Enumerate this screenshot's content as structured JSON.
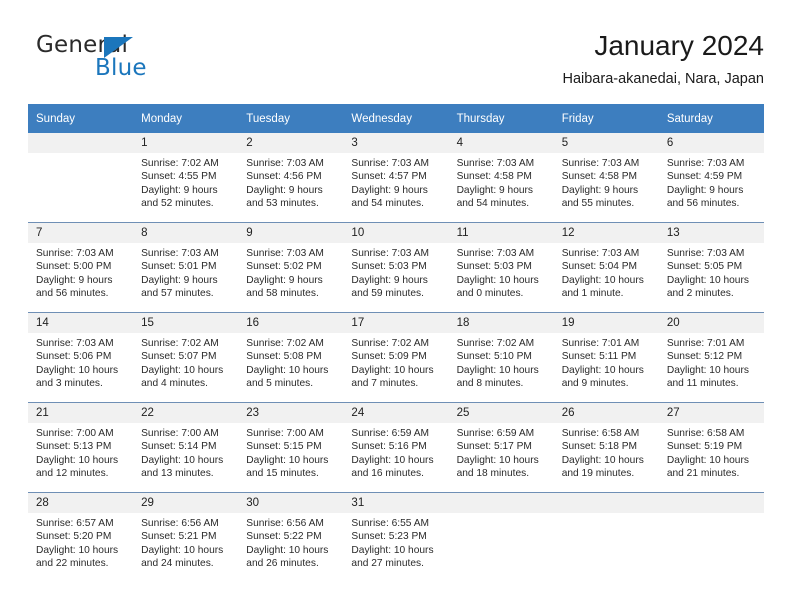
{
  "brand": {
    "word1": "General",
    "word2": "Blue",
    "triangle_color": "#1b76bc",
    "text_color": "#2b2b2b"
  },
  "header": {
    "title": "January 2024",
    "subtitle": "Haibara-akanedai, Nara, Japan"
  },
  "calendar": {
    "header_bg": "#3d7ebf",
    "header_text_color": "#ffffff",
    "daynum_bg": "#f1f1f1",
    "weekday_headers": [
      "Sunday",
      "Monday",
      "Tuesday",
      "Wednesday",
      "Thursday",
      "Friday",
      "Saturday"
    ],
    "weeks": [
      [
        {
          "day": "",
          "sunrise": "",
          "sunset": "",
          "daylight1": "",
          "daylight2": "",
          "empty": true
        },
        {
          "day": "1",
          "sunrise": "Sunrise: 7:02 AM",
          "sunset": "Sunset: 4:55 PM",
          "daylight1": "Daylight: 9 hours",
          "daylight2": "and 52 minutes."
        },
        {
          "day": "2",
          "sunrise": "Sunrise: 7:03 AM",
          "sunset": "Sunset: 4:56 PM",
          "daylight1": "Daylight: 9 hours",
          "daylight2": "and 53 minutes."
        },
        {
          "day": "3",
          "sunrise": "Sunrise: 7:03 AM",
          "sunset": "Sunset: 4:57 PM",
          "daylight1": "Daylight: 9 hours",
          "daylight2": "and 54 minutes."
        },
        {
          "day": "4",
          "sunrise": "Sunrise: 7:03 AM",
          "sunset": "Sunset: 4:58 PM",
          "daylight1": "Daylight: 9 hours",
          "daylight2": "and 54 minutes."
        },
        {
          "day": "5",
          "sunrise": "Sunrise: 7:03 AM",
          "sunset": "Sunset: 4:58 PM",
          "daylight1": "Daylight: 9 hours",
          "daylight2": "and 55 minutes."
        },
        {
          "day": "6",
          "sunrise": "Sunrise: 7:03 AM",
          "sunset": "Sunset: 4:59 PM",
          "daylight1": "Daylight: 9 hours",
          "daylight2": "and 56 minutes."
        }
      ],
      [
        {
          "day": "7",
          "sunrise": "Sunrise: 7:03 AM",
          "sunset": "Sunset: 5:00 PM",
          "daylight1": "Daylight: 9 hours",
          "daylight2": "and 56 minutes."
        },
        {
          "day": "8",
          "sunrise": "Sunrise: 7:03 AM",
          "sunset": "Sunset: 5:01 PM",
          "daylight1": "Daylight: 9 hours",
          "daylight2": "and 57 minutes."
        },
        {
          "day": "9",
          "sunrise": "Sunrise: 7:03 AM",
          "sunset": "Sunset: 5:02 PM",
          "daylight1": "Daylight: 9 hours",
          "daylight2": "and 58 minutes."
        },
        {
          "day": "10",
          "sunrise": "Sunrise: 7:03 AM",
          "sunset": "Sunset: 5:03 PM",
          "daylight1": "Daylight: 9 hours",
          "daylight2": "and 59 minutes."
        },
        {
          "day": "11",
          "sunrise": "Sunrise: 7:03 AM",
          "sunset": "Sunset: 5:03 PM",
          "daylight1": "Daylight: 10 hours",
          "daylight2": "and 0 minutes."
        },
        {
          "day": "12",
          "sunrise": "Sunrise: 7:03 AM",
          "sunset": "Sunset: 5:04 PM",
          "daylight1": "Daylight: 10 hours",
          "daylight2": "and 1 minute."
        },
        {
          "day": "13",
          "sunrise": "Sunrise: 7:03 AM",
          "sunset": "Sunset: 5:05 PM",
          "daylight1": "Daylight: 10 hours",
          "daylight2": "and 2 minutes."
        }
      ],
      [
        {
          "day": "14",
          "sunrise": "Sunrise: 7:03 AM",
          "sunset": "Sunset: 5:06 PM",
          "daylight1": "Daylight: 10 hours",
          "daylight2": "and 3 minutes."
        },
        {
          "day": "15",
          "sunrise": "Sunrise: 7:02 AM",
          "sunset": "Sunset: 5:07 PM",
          "daylight1": "Daylight: 10 hours",
          "daylight2": "and 4 minutes."
        },
        {
          "day": "16",
          "sunrise": "Sunrise: 7:02 AM",
          "sunset": "Sunset: 5:08 PM",
          "daylight1": "Daylight: 10 hours",
          "daylight2": "and 5 minutes."
        },
        {
          "day": "17",
          "sunrise": "Sunrise: 7:02 AM",
          "sunset": "Sunset: 5:09 PM",
          "daylight1": "Daylight: 10 hours",
          "daylight2": "and 7 minutes."
        },
        {
          "day": "18",
          "sunrise": "Sunrise: 7:02 AM",
          "sunset": "Sunset: 5:10 PM",
          "daylight1": "Daylight: 10 hours",
          "daylight2": "and 8 minutes."
        },
        {
          "day": "19",
          "sunrise": "Sunrise: 7:01 AM",
          "sunset": "Sunset: 5:11 PM",
          "daylight1": "Daylight: 10 hours",
          "daylight2": "and 9 minutes."
        },
        {
          "day": "20",
          "sunrise": "Sunrise: 7:01 AM",
          "sunset": "Sunset: 5:12 PM",
          "daylight1": "Daylight: 10 hours",
          "daylight2": "and 11 minutes."
        }
      ],
      [
        {
          "day": "21",
          "sunrise": "Sunrise: 7:00 AM",
          "sunset": "Sunset: 5:13 PM",
          "daylight1": "Daylight: 10 hours",
          "daylight2": "and 12 minutes."
        },
        {
          "day": "22",
          "sunrise": "Sunrise: 7:00 AM",
          "sunset": "Sunset: 5:14 PM",
          "daylight1": "Daylight: 10 hours",
          "daylight2": "and 13 minutes."
        },
        {
          "day": "23",
          "sunrise": "Sunrise: 7:00 AM",
          "sunset": "Sunset: 5:15 PM",
          "daylight1": "Daylight: 10 hours",
          "daylight2": "and 15 minutes."
        },
        {
          "day": "24",
          "sunrise": "Sunrise: 6:59 AM",
          "sunset": "Sunset: 5:16 PM",
          "daylight1": "Daylight: 10 hours",
          "daylight2": "and 16 minutes."
        },
        {
          "day": "25",
          "sunrise": "Sunrise: 6:59 AM",
          "sunset": "Sunset: 5:17 PM",
          "daylight1": "Daylight: 10 hours",
          "daylight2": "and 18 minutes."
        },
        {
          "day": "26",
          "sunrise": "Sunrise: 6:58 AM",
          "sunset": "Sunset: 5:18 PM",
          "daylight1": "Daylight: 10 hours",
          "daylight2": "and 19 minutes."
        },
        {
          "day": "27",
          "sunrise": "Sunrise: 6:58 AM",
          "sunset": "Sunset: 5:19 PM",
          "daylight1": "Daylight: 10 hours",
          "daylight2": "and 21 minutes."
        }
      ],
      [
        {
          "day": "28",
          "sunrise": "Sunrise: 6:57 AM",
          "sunset": "Sunset: 5:20 PM",
          "daylight1": "Daylight: 10 hours",
          "daylight2": "and 22 minutes."
        },
        {
          "day": "29",
          "sunrise": "Sunrise: 6:56 AM",
          "sunset": "Sunset: 5:21 PM",
          "daylight1": "Daylight: 10 hours",
          "daylight2": "and 24 minutes."
        },
        {
          "day": "30",
          "sunrise": "Sunrise: 6:56 AM",
          "sunset": "Sunset: 5:22 PM",
          "daylight1": "Daylight: 10 hours",
          "daylight2": "and 26 minutes."
        },
        {
          "day": "31",
          "sunrise": "Sunrise: 6:55 AM",
          "sunset": "Sunset: 5:23 PM",
          "daylight1": "Daylight: 10 hours",
          "daylight2": "and 27 minutes."
        },
        {
          "day": "",
          "sunrise": "",
          "sunset": "",
          "daylight1": "",
          "daylight2": "",
          "empty": true
        },
        {
          "day": "",
          "sunrise": "",
          "sunset": "",
          "daylight1": "",
          "daylight2": "",
          "empty": true
        },
        {
          "day": "",
          "sunrise": "",
          "sunset": "",
          "daylight1": "",
          "daylight2": "",
          "empty": true
        }
      ]
    ]
  }
}
